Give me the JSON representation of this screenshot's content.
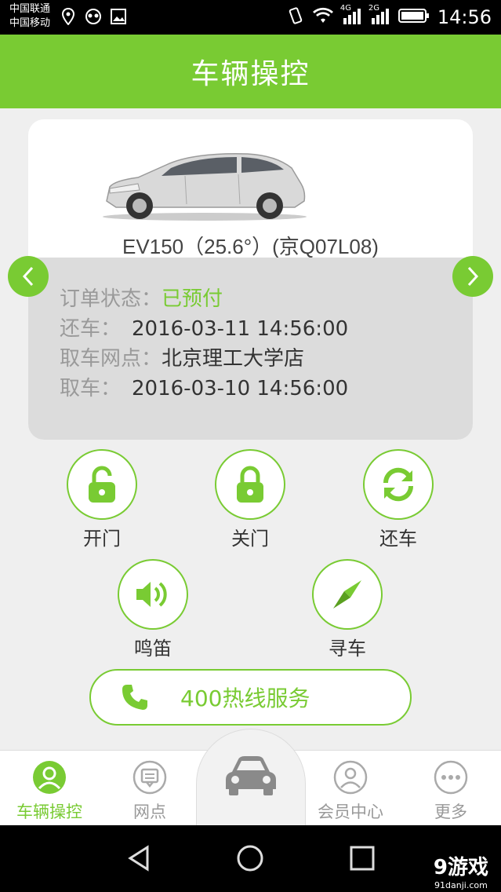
{
  "status_bar": {
    "carrier_1": "中国联通",
    "carrier_2": "中国移动",
    "net_1": "4G",
    "net_2": "2G",
    "time": "14:56"
  },
  "header": {
    "title": "车辆操控"
  },
  "car": {
    "model": "EV150（25.6°）(京Q07L08)"
  },
  "order": {
    "status_label": "订单状态：",
    "status_value": "已预付",
    "return_label": "还车：",
    "return_value": "2016-03-11 14:56:00",
    "station_label": "取车网点：",
    "station_value": "北京理工大学店",
    "pickup_label": "取车：",
    "pickup_value": "2016-03-10 14:56:00"
  },
  "controls": {
    "open_door": "开门",
    "close_door": "关门",
    "return_car": "还车",
    "horn": "鸣笛",
    "find_car": "寻车"
  },
  "hotline": {
    "label": "400热线服务"
  },
  "bottom_nav": {
    "vehicle": "车辆操控",
    "stations": "网点",
    "member": "会员中心",
    "more": "更多"
  },
  "watermark": {
    "brand": "9游戏",
    "site": "91danji.com"
  },
  "colors": {
    "accent": "#79cb33",
    "panel": "#dcdcdc",
    "background": "#efefef"
  },
  "icons": [
    "location-icon",
    "eye-icon",
    "image-icon",
    "vibrate-icon",
    "wifi-icon",
    "signal-icon",
    "battery-icon",
    "unlock-icon",
    "lock-icon",
    "refresh-icon",
    "speaker-icon",
    "compass-icon",
    "phone-icon",
    "user-icon",
    "message-icon",
    "car-icon",
    "more-icon"
  ]
}
